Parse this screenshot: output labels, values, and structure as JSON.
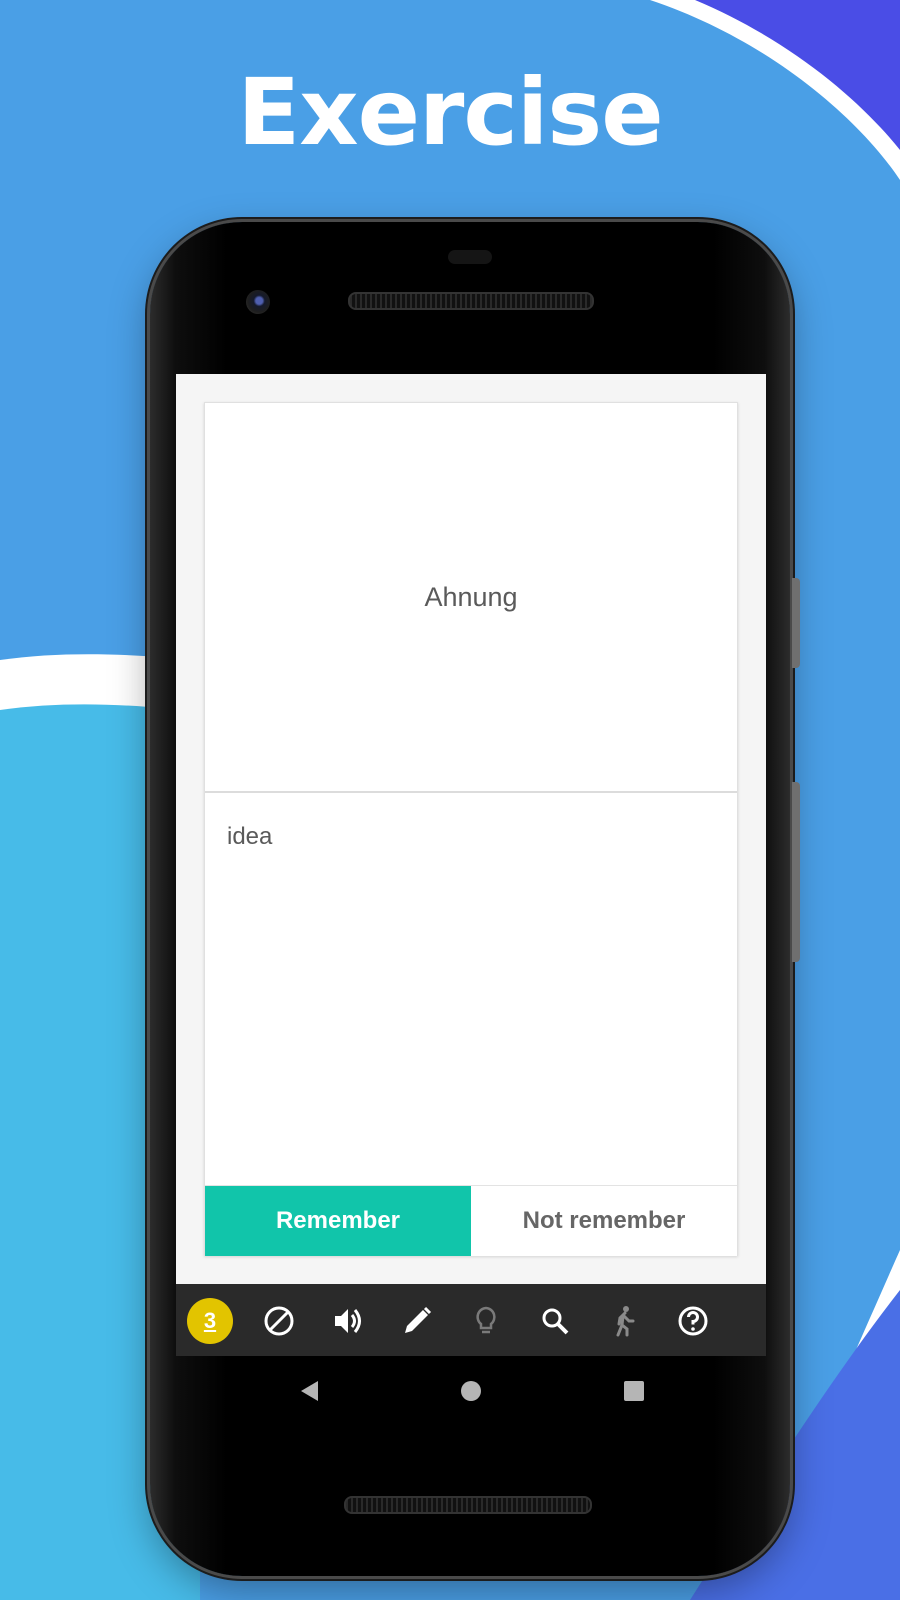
{
  "promo": {
    "title": "Exercise"
  },
  "card": {
    "term": "Ahnung",
    "meaning": "idea",
    "remember_label": "Remember",
    "not_remember_label": "Not remember"
  },
  "toolbar": {
    "badge_count": "3",
    "icons": [
      "block-icon",
      "volume-icon",
      "pencil-icon",
      "lightbulb-icon",
      "search-icon",
      "walk-icon",
      "help-icon"
    ]
  },
  "navbar": {
    "icons": [
      "back-icon",
      "home-icon",
      "recents-icon"
    ]
  },
  "colors": {
    "background": "#4a9fe6",
    "accent": "#11c5aa",
    "badge": "#e2c400",
    "toolbar": "#2a2a2a"
  }
}
